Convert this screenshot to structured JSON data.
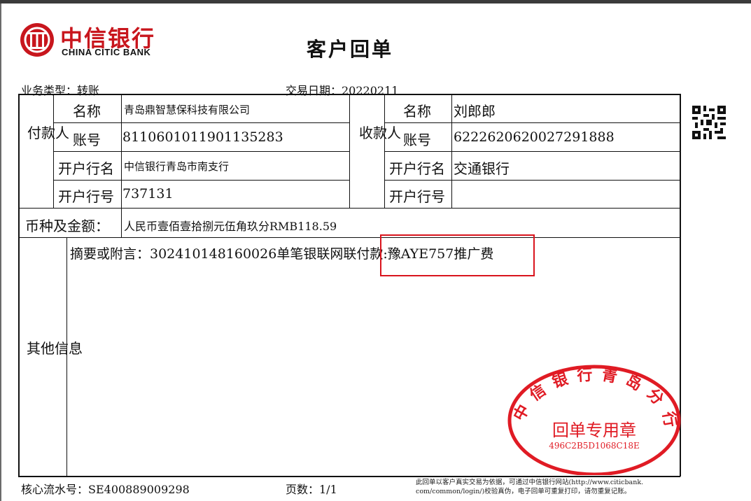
{
  "bank": {
    "name_cn": "中信银行",
    "name_en": "CHINA CITIC BANK"
  },
  "title": "客户回单",
  "business_type": "业务类型：转账",
  "transaction_date": "交易日期：20220211",
  "payer": {
    "section_label": "付款人",
    "name_label": "名称",
    "name": "青岛鼎智慧保科技有限公司",
    "account_label": "账号",
    "account": "8110601011901135283",
    "bank_name_label": "开户行名",
    "bank_name": "中信银行青岛市南支行",
    "bank_code_label": "开户行号",
    "bank_code": "737131"
  },
  "payee": {
    "section_label": "收款人",
    "name_label": "名称",
    "name": "刘郎郎",
    "account_label": "账号",
    "account": "6222620620027291888",
    "bank_name_label": "开户行名",
    "bank_name": "交通银行",
    "bank_code_label": "开户行号",
    "bank_code": ""
  },
  "amount": {
    "label": "币种及金额：",
    "value": "人民币壹佰壹拾捌元伍角玖分RMB118.59"
  },
  "other": {
    "label": "其他信息",
    "memo": "摘要或附言：302410148160026单笔银联网联付款:豫AYE757推广费"
  },
  "footer": {
    "serial": "核心流水号：SE400889009298",
    "page": "页数：1/1",
    "notice_line1": "此回单以客户真实交易为依据，可通过中信银行网站(http://www.citicbank.",
    "notice_line2": "com/common/login/)校验真伪，电子回单可重复打印，请勿重复记账。"
  },
  "stamp": {
    "ring_text": "中信银行青岛分行",
    "center_text": "回单专用章",
    "code": "496C2B5D1068C18E"
  },
  "colors": {
    "brand_red": "#c8161d",
    "stamp_red": "#e01b24",
    "highlight_box": "#d9141d"
  }
}
